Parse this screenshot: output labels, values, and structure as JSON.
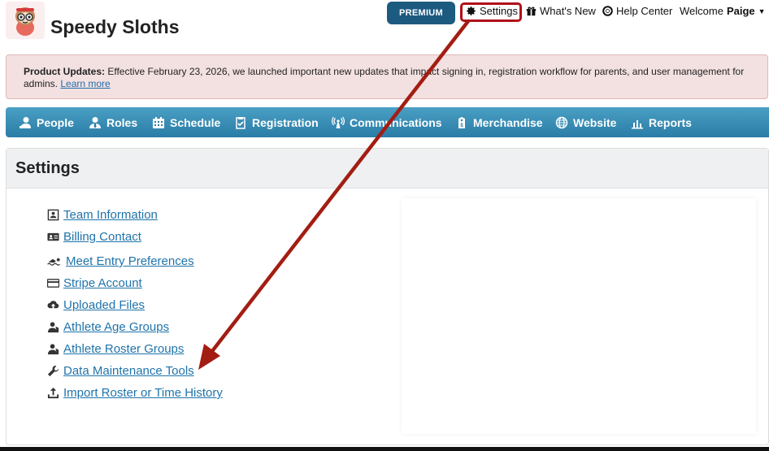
{
  "header": {
    "team_name": "Speedy Sloths",
    "premium_label": "PREMIUM",
    "settings_label": "Settings",
    "whats_new_label": "What's New",
    "help_center_label": "Help Center",
    "welcome_prefix": "Welcome",
    "user_name": "Paige"
  },
  "banner": {
    "bold": "Product Updates:",
    "text": " Effective February 23, 2026, we launched important new updates that impact signing in, registration workflow for parents, and user management for admins. ",
    "link": "Learn more"
  },
  "nav": {
    "items": [
      {
        "label": "People",
        "icon": "person-icon"
      },
      {
        "label": "Roles",
        "icon": "user-tie-icon"
      },
      {
        "label": "Schedule",
        "icon": "calendar-icon"
      },
      {
        "label": "Registration",
        "icon": "clipboard-check-icon"
      },
      {
        "label": "Communications",
        "icon": "broadcast-icon"
      },
      {
        "label": "Merchandise",
        "icon": "tag-icon"
      },
      {
        "label": "Website",
        "icon": "globe-icon"
      },
      {
        "label": "Reports",
        "icon": "bar-chart-icon"
      }
    ]
  },
  "panel": {
    "title": "Settings",
    "links": [
      {
        "label": "Team Information",
        "icon": "id-document-icon"
      },
      {
        "label": "Billing Contact",
        "icon": "address-card-icon"
      },
      {
        "label": "Meet Entry Preferences",
        "icon": "swimmer-icon"
      },
      {
        "label": "Stripe Account",
        "icon": "credit-card-icon"
      },
      {
        "label": "Uploaded Files",
        "icon": "cloud-upload-icon"
      },
      {
        "label": "Athlete Age Groups",
        "icon": "users-icon"
      },
      {
        "label": "Athlete Roster Groups",
        "icon": "users-icon"
      },
      {
        "label": "Data Maintenance Tools",
        "icon": "wrench-icon"
      },
      {
        "label": "Import Roster or Time History",
        "icon": "upload-icon"
      }
    ]
  },
  "annotation": {
    "highlight_color": "#b0101a",
    "arrow_color": "#a31d12"
  }
}
